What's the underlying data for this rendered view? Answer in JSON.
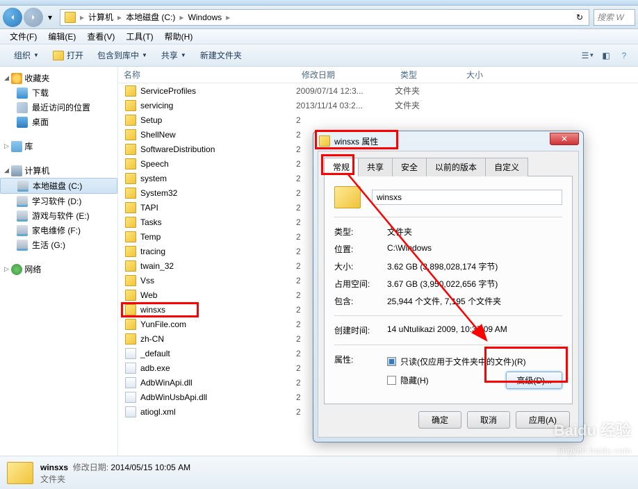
{
  "breadcrumb": {
    "seg1": "计算机",
    "seg2": "本地磁盘 (C:)",
    "seg3": "Windows"
  },
  "search_placeholder": "搜索 W",
  "menus": {
    "file": "文件(F)",
    "edit": "编辑(E)",
    "view": "查看(V)",
    "tools": "工具(T)",
    "help": "帮助(H)"
  },
  "toolbar": {
    "organize": "组织",
    "open": "打开",
    "include": "包含到库中",
    "share": "共享",
    "newfolder": "新建文件夹"
  },
  "sidebar": {
    "favorites": "收藏夹",
    "downloads": "下载",
    "recent": "最近访问的位置",
    "desktop": "桌面",
    "libraries": "库",
    "computer": "计算机",
    "drive_c": "本地磁盘 (C:)",
    "drive_d": "学习软件 (D:)",
    "drive_e": "游戏与软件 (E:)",
    "drive_f": "家电维修 (F:)",
    "drive_g": "生活 (G:)",
    "network": "网络"
  },
  "columns": {
    "name": "名称",
    "date": "修改日期",
    "type": "类型",
    "size": "大小"
  },
  "files": [
    {
      "name": "ServiceProfiles",
      "date": "2009/07/14 12:3...",
      "type": "文件夹",
      "icon": "folder"
    },
    {
      "name": "servicing",
      "date": "2013/11/14 03:2...",
      "type": "文件夹",
      "icon": "folder"
    },
    {
      "name": "Setup",
      "date": "2",
      "type": "",
      "icon": "folder"
    },
    {
      "name": "ShellNew",
      "date": "2",
      "type": "",
      "icon": "folder"
    },
    {
      "name": "SoftwareDistribution",
      "date": "2",
      "type": "",
      "icon": "folder"
    },
    {
      "name": "Speech",
      "date": "2",
      "type": "",
      "icon": "folder"
    },
    {
      "name": "system",
      "date": "2",
      "type": "",
      "icon": "folder"
    },
    {
      "name": "System32",
      "date": "2",
      "type": "",
      "icon": "folder"
    },
    {
      "name": "TAPI",
      "date": "2",
      "type": "",
      "icon": "folder"
    },
    {
      "name": "Tasks",
      "date": "2",
      "type": "",
      "icon": "folder"
    },
    {
      "name": "Temp",
      "date": "2",
      "type": "",
      "icon": "folder"
    },
    {
      "name": "tracing",
      "date": "2",
      "type": "",
      "icon": "folder"
    },
    {
      "name": "twain_32",
      "date": "2",
      "type": "",
      "icon": "folder"
    },
    {
      "name": "Vss",
      "date": "2",
      "type": "",
      "icon": "folder"
    },
    {
      "name": "Web",
      "date": "2",
      "type": "",
      "icon": "folder"
    },
    {
      "name": "winsxs",
      "date": "2",
      "type": "",
      "icon": "folder"
    },
    {
      "name": "YunFile.com",
      "date": "2",
      "type": "",
      "icon": "folder"
    },
    {
      "name": "zh-CN",
      "date": "2",
      "type": "",
      "icon": "folder"
    },
    {
      "name": "_default",
      "date": "2",
      "type": "",
      "icon": "file"
    },
    {
      "name": "adb.exe",
      "date": "2",
      "type": "",
      "icon": "file"
    },
    {
      "name": "AdbWinApi.dll",
      "date": "2",
      "type": "",
      "icon": "file"
    },
    {
      "name": "AdbWinUsbApi.dll",
      "date": "2",
      "type": "",
      "icon": "file"
    },
    {
      "name": "atiogl.xml",
      "date": "2",
      "type": "",
      "icon": "file"
    }
  ],
  "status": {
    "name": "winsxs",
    "date_label": "修改日期:",
    "date_value": "2014/05/15 10:05 AM",
    "type": "文件夹"
  },
  "dialog": {
    "title": "winsxs 属性",
    "tabs": {
      "general": "常规",
      "sharing": "共享",
      "security": "安全",
      "previous": "以前的版本",
      "custom": "自定义"
    },
    "name_value": "winsxs",
    "rows": {
      "type_label": "类型:",
      "type_value": "文件夹",
      "loc_label": "位置:",
      "loc_value": "C:\\Windows",
      "size_label": "大小:",
      "size_value": "3.62 GB (3,898,028,174 字节)",
      "disk_label": "占用空间:",
      "disk_value": "3.67 GB (3,950,022,656 字节)",
      "contains_label": "包含:",
      "contains_value": "25,944 个文件, 7,195 个文件夹",
      "created_label": "创建时间:",
      "created_value": "14 uNtulikazi 2009, 10:37:09 AM",
      "attr_label": "属性:",
      "readonly": "只读(仅应用于文件夹中的文件)(R)",
      "hidden": "隐藏(H)",
      "advanced": "高级(D)..."
    },
    "buttons": {
      "ok": "确定",
      "cancel": "取消",
      "apply": "应用(A)"
    }
  },
  "watermark": "Baidu 经验",
  "watermark_url": "jingyan.baidu.com"
}
